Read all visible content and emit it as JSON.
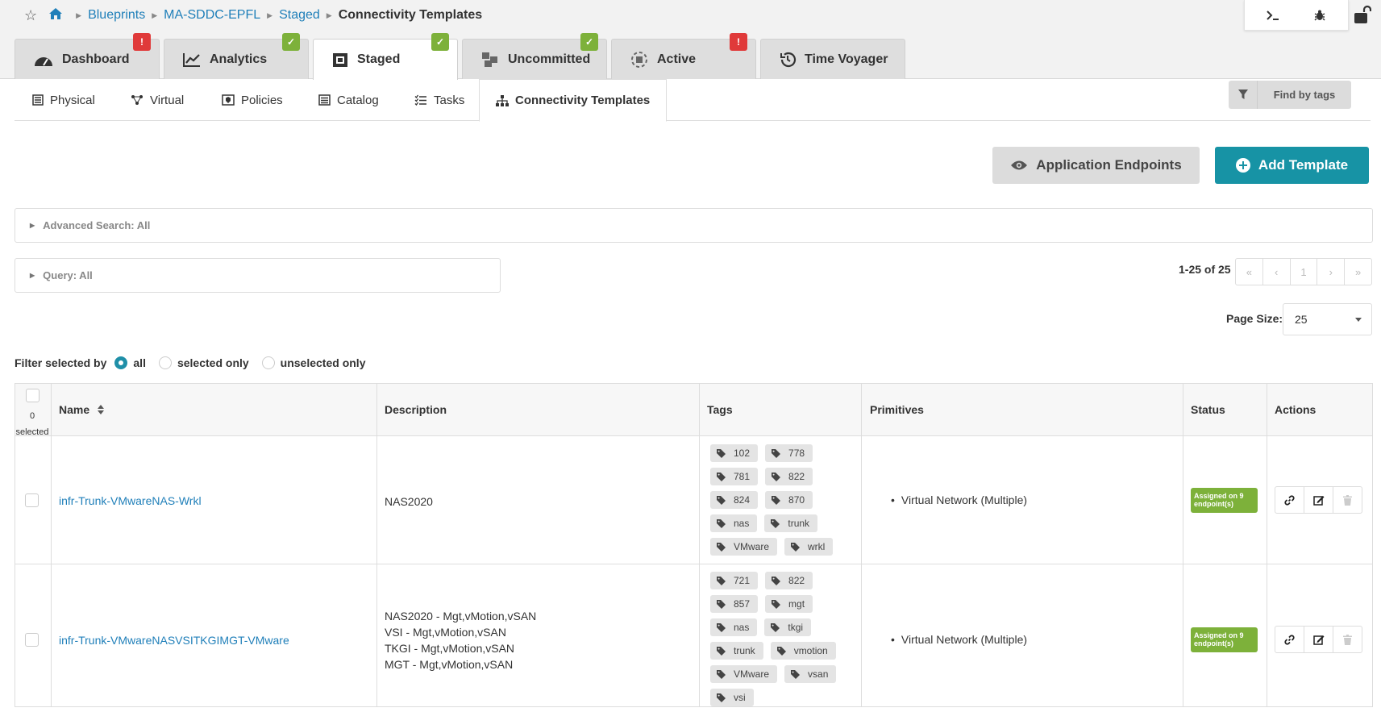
{
  "breadcrumb": {
    "items": [
      "Blueprints",
      "MA-SDDC-EPFL",
      "Staged"
    ],
    "current": "Connectivity Templates"
  },
  "main_tabs": [
    {
      "label": "Dashboard",
      "badge": "warning"
    },
    {
      "label": "Analytics",
      "badge": "ok"
    },
    {
      "label": "Staged",
      "badge": "ok"
    },
    {
      "label": "Uncommitted",
      "badge": "ok"
    },
    {
      "label": "Active",
      "badge": "warning"
    },
    {
      "label": "Time Voyager",
      "badge": ""
    }
  ],
  "sub_tabs": [
    "Physical",
    "Virtual",
    "Policies",
    "Catalog",
    "Tasks",
    "Connectivity Templates"
  ],
  "find_by_tags": "Find by tags",
  "buttons": {
    "app_endpoints": "Application Endpoints",
    "add_template": "Add Template"
  },
  "advanced_search": "Advanced Search: All",
  "query": "Query: All",
  "pagination": {
    "count": "1-25 of 25",
    "first": "«",
    "prev": "‹",
    "page": "1",
    "next": "›",
    "last": "»",
    "page_size_label": "Page Size:",
    "page_size": "25"
  },
  "filter": {
    "label": "Filter selected by",
    "options": [
      "all",
      "selected only",
      "unselected only"
    ],
    "selected": "all"
  },
  "table": {
    "selected_count": "0",
    "selected_label": "selected",
    "headers": [
      "Name",
      "Description",
      "Tags",
      "Primitives",
      "Status",
      "Actions"
    ],
    "rows": [
      {
        "name": "infr-Trunk-VMwareNAS-Wrkl",
        "description": [
          "NAS2020"
        ],
        "tags": [
          "102",
          "778",
          "781",
          "822",
          "824",
          "870",
          "nas",
          "trunk",
          "VMware",
          "wrkl"
        ],
        "primitive": "Virtual Network (Multiple)",
        "status": "Assigned on 9 endpoint(s)"
      },
      {
        "name": "infr-Trunk-VMwareNASVSITKGIMGT-VMware",
        "description": [
          "NAS2020 - Mgt,vMotion,vSAN",
          "VSI - Mgt,vMotion,vSAN",
          "TKGI - Mgt,vMotion,vSAN",
          "MGT - Mgt,vMotion,vSAN"
        ],
        "tags": [
          "721",
          "822",
          "857",
          "mgt",
          "nas",
          "tkgi",
          "trunk",
          "vmotion",
          "VMware",
          "vsan",
          "vsi"
        ],
        "primitive": "Virtual Network (Multiple)",
        "status": "Assigned on 9 endpoint(s)"
      }
    ]
  },
  "colors": {
    "accent": "#1793a5",
    "link": "#1f7fb9",
    "status_ok": "#7db13a",
    "warning": "#e03a3a"
  }
}
